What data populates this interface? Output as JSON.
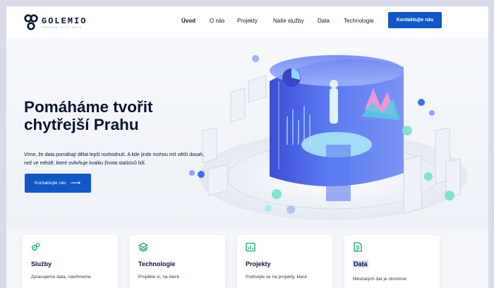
{
  "brand": {
    "name": "GOLEMIO",
    "tagline": "PRAGUE CITY DATA"
  },
  "nav": {
    "items": [
      {
        "label": "Úvod",
        "active": true
      },
      {
        "label": "O nás",
        "active": false
      },
      {
        "label": "Projekty",
        "active": false
      },
      {
        "label": "Naše služby",
        "active": false
      },
      {
        "label": "Data",
        "active": false
      },
      {
        "label": "Technologie",
        "active": false
      }
    ],
    "cta": "Kontaktujte nás"
  },
  "hero": {
    "title_line1": "Pomáháme tvořit",
    "title_line2": "chytřejší Prahu",
    "text_line1": "Víme, že data pomáhají dělat lepší rozhodnutí. A kde jinde mohou mít větší dosah,",
    "text_line2": "než ve městě, které ovlivňuje kvalitu života statisíců lidí.",
    "cta": "Kontaktujte nás",
    "cta_arrow": "⟶"
  },
  "cards": [
    {
      "title": "Služby",
      "desc": "Zpracujeme data, navrhneme",
      "icon": "gears-icon"
    },
    {
      "title": "Technologie",
      "desc": "Projděte si, na které",
      "icon": "layers-icon"
    },
    {
      "title": "Projekty",
      "desc": "Podívejte se na projekty, které",
      "icon": "chart-window-icon"
    },
    {
      "title": "Data",
      "desc": "Městských dat je ohromné",
      "icon": "data-document-icon",
      "highlighted": true
    }
  ],
  "colors": {
    "accent": "#1057c8",
    "text": "#0b1530",
    "background": "#f4f6fa",
    "frame": "#d9dbea"
  }
}
